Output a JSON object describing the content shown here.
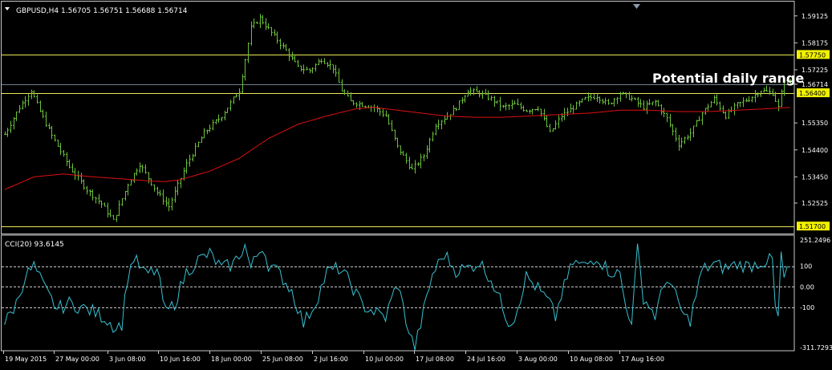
{
  "header": {
    "symbol_line": "GBPUSD,H4  1.56705 1.56751 1.56688 1.56714"
  },
  "annotation": {
    "text": "Potential daily range"
  },
  "colors": {
    "background": "#000000",
    "bar": "#6bbf3a",
    "ma": "#e01010",
    "level": "#e8e858",
    "current_line": "#708090",
    "cci": "#38c0d0",
    "axis_text": "#ffffff",
    "frame": "#c8c8c8",
    "highlight_fill": "#f0f000"
  },
  "chart_data": [
    {
      "type": "ohlc",
      "ylim": [
        1.5145,
        1.596
      ],
      "y_ticks": [
        "1.59125",
        "1.58175",
        "1.57225",
        "1.56714",
        "1.55350",
        "1.54400",
        "1.53450",
        "1.52525"
      ],
      "horizontal_levels": [
        {
          "value": 1.5775,
          "label": "1.57750"
        },
        {
          "value": 1.564,
          "label": "1.56400"
        },
        {
          "value": 1.517,
          "label": "1.51700"
        }
      ],
      "current_price": {
        "value": 1.56714,
        "label": "1.56714"
      },
      "x_ticks": [
        "19 May 2015",
        "27 May 00:00",
        "3 Jun 08:00",
        "10 Jun 16:00",
        "18 Jun 00:00",
        "25 Jun 08:00",
        "2 Jul 16:00",
        "10 Jul 00:00",
        "17 Jul 08:00",
        "24 Jul 16:00",
        "3 Aug 00:00",
        "10 Aug 08:00",
        "17 Aug 16:00"
      ],
      "close_keypoints": [
        [
          0,
          1.5495
        ],
        [
          5,
          1.559
        ],
        [
          9,
          1.565
        ],
        [
          12,
          1.5575
        ],
        [
          16,
          1.549
        ],
        [
          22,
          1.538
        ],
        [
          28,
          1.53
        ],
        [
          33,
          1.525
        ],
        [
          37,
          1.519
        ],
        [
          42,
          1.532
        ],
        [
          46,
          1.539
        ],
        [
          52,
          1.529
        ],
        [
          56,
          1.524
        ],
        [
          62,
          1.539
        ],
        [
          68,
          1.55
        ],
        [
          74,
          1.556
        ],
        [
          80,
          1.565
        ],
        [
          84,
          1.587
        ],
        [
          87,
          1.5905
        ],
        [
          92,
          1.584
        ],
        [
          96,
          1.579
        ],
        [
          100,
          1.573
        ],
        [
          104,
          1.572
        ],
        [
          108,
          1.576
        ],
        [
          112,
          1.573
        ],
        [
          115,
          1.565
        ],
        [
          118,
          1.561
        ],
        [
          122,
          1.56
        ],
        [
          126,
          1.559
        ],
        [
          130,
          1.556
        ],
        [
          134,
          1.545
        ],
        [
          139,
          1.537
        ],
        [
          143,
          1.542
        ],
        [
          147,
          1.553
        ],
        [
          151,
          1.556
        ],
        [
          154,
          1.559
        ],
        [
          158,
          1.565
        ],
        [
          162,
          1.564
        ],
        [
          166,
          1.562
        ],
        [
          170,
          1.559
        ],
        [
          174,
          1.56
        ],
        [
          178,
          1.558
        ],
        [
          182,
          1.559
        ],
        [
          186,
          1.55
        ],
        [
          190,
          1.556
        ],
        [
          194,
          1.559
        ],
        [
          198,
          1.562
        ],
        [
          202,
          1.563
        ],
        [
          206,
          1.56
        ],
        [
          210,
          1.564
        ],
        [
          214,
          1.562
        ],
        [
          218,
          1.559
        ],
        [
          222,
          1.561
        ],
        [
          226,
          1.555
        ],
        [
          230,
          1.546
        ],
        [
          234,
          1.55
        ],
        [
          238,
          1.557
        ],
        [
          242,
          1.562
        ],
        [
          246,
          1.556
        ],
        [
          250,
          1.56
        ],
        [
          254,
          1.562
        ],
        [
          258,
          1.565
        ],
        [
          262,
          1.564
        ],
        [
          264,
          1.559
        ],
        [
          266,
          1.569
        ],
        [
          268,
          1.5671
        ]
      ],
      "ma_keypoints": [
        [
          0,
          1.53
        ],
        [
          10,
          1.5345
        ],
        [
          20,
          1.5355
        ],
        [
          30,
          1.5345
        ],
        [
          40,
          1.5338
        ],
        [
          50,
          1.533
        ],
        [
          55,
          1.5328
        ],
        [
          60,
          1.5335
        ],
        [
          70,
          1.5365
        ],
        [
          80,
          1.541
        ],
        [
          90,
          1.548
        ],
        [
          100,
          1.553
        ],
        [
          110,
          1.556
        ],
        [
          120,
          1.5585
        ],
        [
          126,
          1.559
        ],
        [
          134,
          1.558
        ],
        [
          142,
          1.557
        ],
        [
          150,
          1.556
        ],
        [
          160,
          1.5555
        ],
        [
          170,
          1.5555
        ],
        [
          180,
          1.556
        ],
        [
          190,
          1.5565
        ],
        [
          200,
          1.557
        ],
        [
          210,
          1.558
        ],
        [
          220,
          1.558
        ],
        [
          230,
          1.5575
        ],
        [
          240,
          1.5575
        ],
        [
          250,
          1.558
        ],
        [
          260,
          1.5585
        ],
        [
          268,
          1.559
        ]
      ]
    },
    {
      "type": "line",
      "title": "CCI(20) 93.6145",
      "ylim": [
        -311.7293,
        251.2496
      ],
      "y_ticks": [
        "251.2496",
        "100",
        "0.00",
        "-100",
        "-311.7293"
      ],
      "reference_lines": [
        100,
        0,
        -100
      ],
      "keypoints": [
        [
          0,
          -180
        ],
        [
          4,
          -80
        ],
        [
          7,
          50
        ],
        [
          10,
          100
        ],
        [
          14,
          -20
        ],
        [
          18,
          -110
        ],
        [
          22,
          -80
        ],
        [
          26,
          -100
        ],
        [
          30,
          -120
        ],
        [
          34,
          -150
        ],
        [
          38,
          -200
        ],
        [
          40,
          -180
        ],
        [
          42,
          50
        ],
        [
          44,
          140
        ],
        [
          48,
          60
        ],
        [
          52,
          80
        ],
        [
          55,
          -130
        ],
        [
          58,
          -80
        ],
        [
          62,
          70
        ],
        [
          66,
          130
        ],
        [
          70,
          160
        ],
        [
          74,
          90
        ],
        [
          78,
          110
        ],
        [
          82,
          200
        ],
        [
          84,
          90
        ],
        [
          86,
          150
        ],
        [
          88,
          200
        ],
        [
          90,
          110
        ],
        [
          94,
          60
        ],
        [
          98,
          -20
        ],
        [
          102,
          -180
        ],
        [
          106,
          -80
        ],
        [
          110,
          70
        ],
        [
          114,
          90
        ],
        [
          118,
          20
        ],
        [
          122,
          -90
        ],
        [
          126,
          -120
        ],
        [
          130,
          -150
        ],
        [
          134,
          20
        ],
        [
          138,
          -220
        ],
        [
          140,
          -300
        ],
        [
          142,
          -180
        ],
        [
          146,
          60
        ],
        [
          150,
          160
        ],
        [
          154,
          80
        ],
        [
          158,
          90
        ],
        [
          162,
          120
        ],
        [
          166,
          40
        ],
        [
          170,
          -100
        ],
        [
          172,
          -170
        ],
        [
          174,
          -150
        ],
        [
          178,
          50
        ],
        [
          182,
          -10
        ],
        [
          186,
          -80
        ],
        [
          188,
          -150
        ],
        [
          190,
          -40
        ],
        [
          194,
          120
        ],
        [
          198,
          100
        ],
        [
          202,
          150
        ],
        [
          206,
          80
        ],
        [
          210,
          60
        ],
        [
          212,
          -100
        ],
        [
          214,
          -160
        ],
        [
          216,
          180
        ],
        [
          218,
          -50
        ],
        [
          222,
          -140
        ],
        [
          226,
          50
        ],
        [
          230,
          -80
        ],
        [
          232,
          -150
        ],
        [
          234,
          -160
        ],
        [
          238,
          80
        ],
        [
          242,
          110
        ],
        [
          246,
          90
        ],
        [
          250,
          110
        ],
        [
          254,
          100
        ],
        [
          258,
          120
        ],
        [
          262,
          130
        ],
        [
          263,
          -100
        ],
        [
          264,
          -160
        ],
        [
          265,
          160
        ],
        [
          266,
          40
        ],
        [
          268,
          93.6
        ]
      ]
    }
  ]
}
